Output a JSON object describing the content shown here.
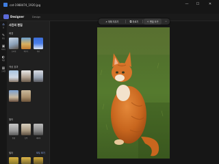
{
  "window": {
    "title": "cat-1988474_1920.jpg",
    "minimize": "—",
    "maximize": "☐",
    "close": "✕"
  },
  "app": {
    "name": "Designer",
    "section": "Design"
  },
  "rail": {
    "items": [
      {
        "icon": "home-icon",
        "glyph": "⌂",
        "label": "홈"
      },
      {
        "icon": "edit-icon",
        "glyph": "✎",
        "label": "편집"
      },
      {
        "icon": "image-icon",
        "glyph": "▣",
        "label": "이미지"
      },
      {
        "icon": "mask-icon",
        "glyph": "◐",
        "label": "배경"
      },
      {
        "icon": "grid-icon",
        "glyph": "▦",
        "label": "스타일"
      }
    ]
  },
  "panel": {
    "title": "사진의 편집",
    "sections": [
      {
        "title": "배경",
        "labels": [
          "흐리게",
          "바꾸기",
          "제거"
        ]
      },
      {
        "title": "색상 효과",
        "labels": [
          "",
          "",
          "",
          ""
        ]
      },
      {
        "title": "필터",
        "labels": [
          "변경",
          "흑백",
          "세피아"
        ]
      },
      {
        "title": "필터",
        "more": "모두 보기"
      }
    ]
  },
  "toolbar": {
    "erase": "개체 지우기",
    "crop": "자르기",
    "edit": "편집 도구",
    "more": "⋯"
  },
  "colors": {
    "accent": "#8fb1ff",
    "panel_bg": "#202020",
    "canvas_bg": "#161616"
  }
}
